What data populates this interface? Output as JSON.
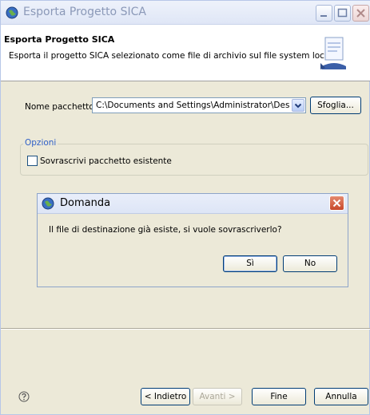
{
  "window": {
    "title": "Esporta Progetto SICA",
    "buttons": [
      "minimize-icon",
      "maximize-icon",
      "close-icon"
    ]
  },
  "header": {
    "title": "Esporta Progetto SICA",
    "description": "Esporta il progetto SICA selezionato come file di archivio sul file system locale"
  },
  "form": {
    "package_label": "Nome pacchetto:",
    "package_value": "C:\\Documents and Settings\\Administrator\\Desktop\\bi",
    "browse_label": "Sfoglia...",
    "options_group": "Opzioni",
    "overwrite_label": "Sovrascrivi pacchetto esistente",
    "overwrite_checked": false
  },
  "dialog": {
    "title": "Domanda",
    "message": "Il file di destinazione già esiste, si vuole sovrascriverlo?",
    "yes_label": "Sì",
    "no_label": "No"
  },
  "footer": {
    "back_label": "< Indietro",
    "next_label": "Avanti >",
    "finish_label": "Fine",
    "cancel_label": "Annulla"
  },
  "colors": {
    "accent": "#2e5fc7",
    "window_bg": "#ece9d8",
    "close_red": "#c8482a"
  }
}
